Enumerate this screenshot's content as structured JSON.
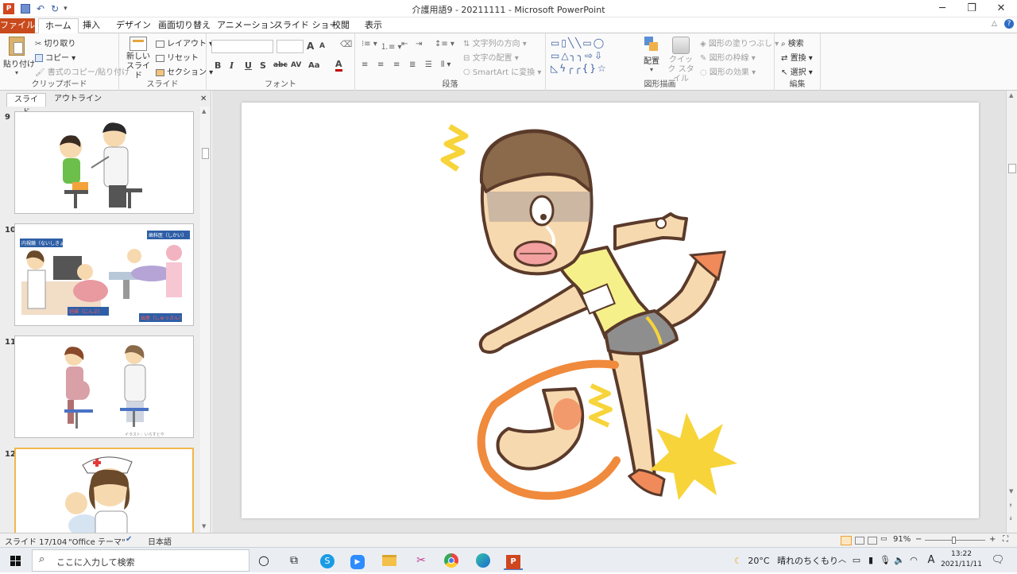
{
  "window": {
    "title": "介護用語9 - 20211111 - Microsoft PowerPoint",
    "minimize": "─",
    "restore": "❐",
    "close": "✕"
  },
  "ribbon_tabs": [
    "ファイル",
    "ホーム",
    "挿入",
    "デザイン",
    "画面切り替え",
    "アニメーション",
    "スライド ショー",
    "校閲",
    "表示"
  ],
  "ribbon": {
    "clipboard": {
      "paste": "貼り付け",
      "cut": "切り取り",
      "copy": "コピー",
      "format_painter": "書式のコピー/貼り付け",
      "label": "クリップボード"
    },
    "slides": {
      "new_slide": "新しい スライド",
      "layout": "レイアウト",
      "reset": "リセット",
      "section": "セクション",
      "label": "スライド"
    },
    "font": {
      "label": "フォント",
      "bold": "B",
      "italic": "I",
      "underline": "U",
      "shadow": "S",
      "strike": "abc",
      "spacing": "AV",
      "case": "Aa",
      "grow": "A",
      "shrink": "A",
      "color": "A"
    },
    "paragraph": {
      "text_direction": "文字列の方向",
      "align_text": "文字の配置",
      "smartart": "SmartArt に変換",
      "label": "段落"
    },
    "drawing": {
      "arrange": "配置",
      "quick_styles": "クイック スタイル",
      "shape_fill": "図形の塗りつぶし",
      "shape_outline": "図形の枠線",
      "shape_effects": "図形の効果",
      "label": "図形描画"
    },
    "editing": {
      "find": "検索",
      "replace": "置換",
      "select": "選択",
      "label": "編集"
    }
  },
  "left_pane": {
    "tab_slides": "スライド",
    "tab_outline": "アウトライン",
    "close": "✕",
    "thumbnails": [
      {
        "number": "9"
      },
      {
        "number": "10",
        "label1": "内視鏡（ないしきょう）",
        "label2": "歯科医（しかい）",
        "label3": "妊婦（にんぷ）",
        "label4": "出産（しゅっさん）"
      },
      {
        "number": "11",
        "caption": "イラスト：いらすとや"
      },
      {
        "number": "12"
      }
    ]
  },
  "status": {
    "slide_info": "スライド 17/104",
    "theme": "\"Office テーマ\"",
    "language": "日本語",
    "zoom": "91%",
    "zoom_minus": "−",
    "zoom_plus": "+"
  },
  "taskbar": {
    "search_placeholder": "ここに入力して検索",
    "weather_temp": "20°C",
    "weather_desc": "晴れのちくもり",
    "ime": "A",
    "time": "13:22",
    "date": "2021/11/11"
  },
  "colors": {
    "file_tab": "#c94a1c",
    "skin": "#f7d9b0",
    "hair": "#8a6a4a",
    "shirt": "#f6f08a",
    "shorts": "#8e8e8e",
    "pain_orange": "#f08a3c",
    "pain_yellow": "#f7d43a"
  },
  "icons": [
    "powerpoint-icon",
    "save-icon",
    "undo-icon",
    "redo-icon",
    "paste-icon",
    "scissors-icon",
    "copy-icon",
    "brush-icon",
    "new-slide-icon",
    "search-icon",
    "windows-start-icon",
    "cortana-icon",
    "task-view-icon",
    "skype-icon",
    "zoom-icon",
    "folder-icon",
    "snip-icon",
    "chrome-icon",
    "edge-icon",
    "powerpoint-taskbar-icon",
    "weather-icon",
    "notification-icon"
  ]
}
